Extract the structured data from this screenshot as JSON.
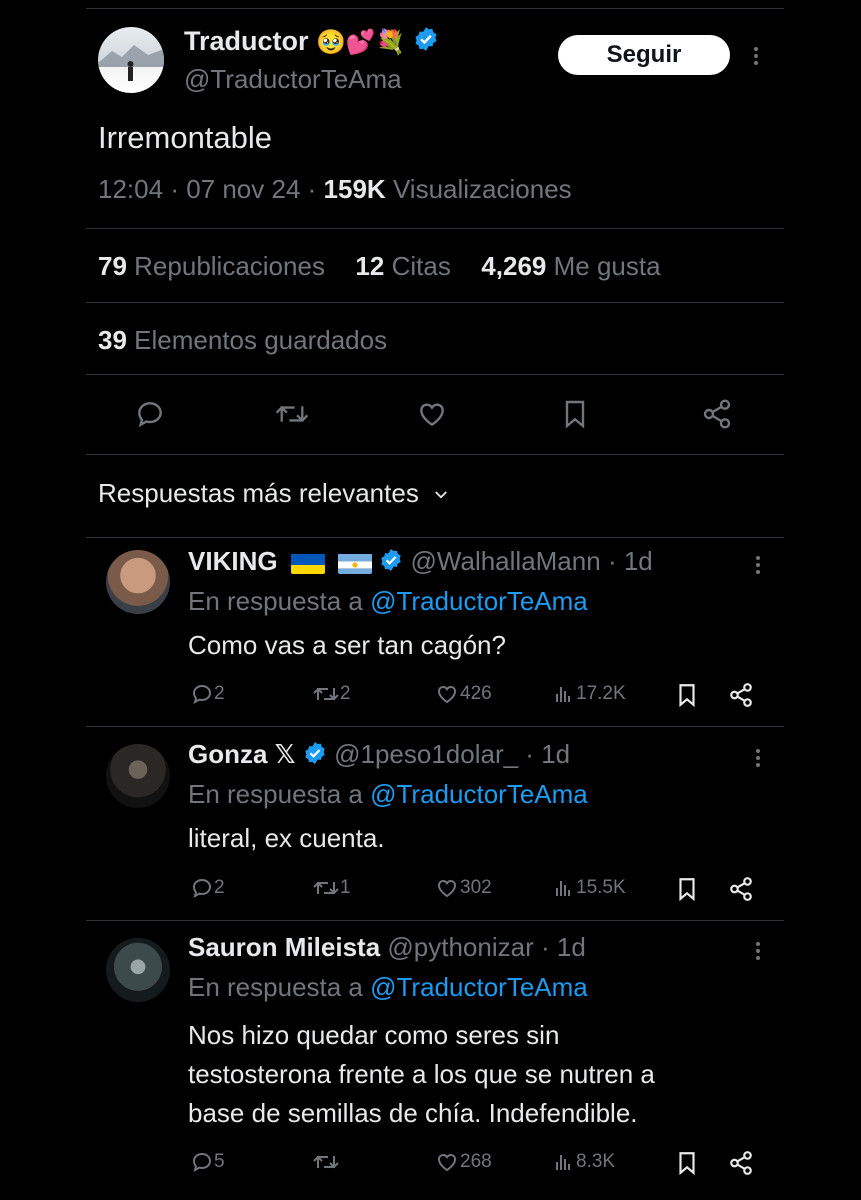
{
  "tweet": {
    "author_name": "Traductor",
    "author_emojis": "🥹💕💐",
    "author_handle": "@TraductorTeAma",
    "follow_label": "Seguir",
    "text": "Irremontable",
    "time": "12:04",
    "date": "07 nov 24",
    "views_count": "159K",
    "views_label": "Visualizaciones",
    "reposts_count": "79",
    "reposts_label": "Republicaciones",
    "quotes_count": "12",
    "quotes_label": "Citas",
    "likes_count": "4,269",
    "likes_label": "Me gusta",
    "bookmarks_count": "39",
    "bookmarks_label": "Elementos guardados"
  },
  "replies_header": "Respuestas más relevantes",
  "replies": [
    {
      "name": "VIKING",
      "handle": "@WalhallaMann",
      "time": "1d",
      "reply_prefix": "En respuesta a",
      "reply_to": "@TraductorTeAma",
      "text": "Como vas a ser tan cagón?",
      "replies": "2",
      "reposts": "2",
      "likes": "426",
      "views": "17.2K"
    },
    {
      "name": "Gonza 𝕏",
      "handle": "@1peso1dolar_",
      "time": "1d",
      "reply_prefix": "En respuesta a",
      "reply_to": "@TraductorTeAma",
      "text": "literal, ex cuenta.",
      "replies": "2",
      "reposts": "1",
      "likes": "302",
      "views": "15.5K"
    },
    {
      "name": "Sauron Mileista",
      "handle": "@pythonizar",
      "time": "1d",
      "reply_prefix": "En respuesta a",
      "reply_to": "@TraductorTeAma",
      "text_lines": [
        "Nos hizo quedar como seres sin",
        "testosterona frente a los que se nutren a",
        "base de semillas de chía. Indefendible."
      ],
      "replies": "5",
      "reposts": "",
      "likes": "268",
      "views": "8.3K"
    }
  ],
  "colors": {
    "background": "#000000",
    "accent": "#1d9bf0",
    "muted": "#71767b",
    "divider": "#2f3336"
  }
}
